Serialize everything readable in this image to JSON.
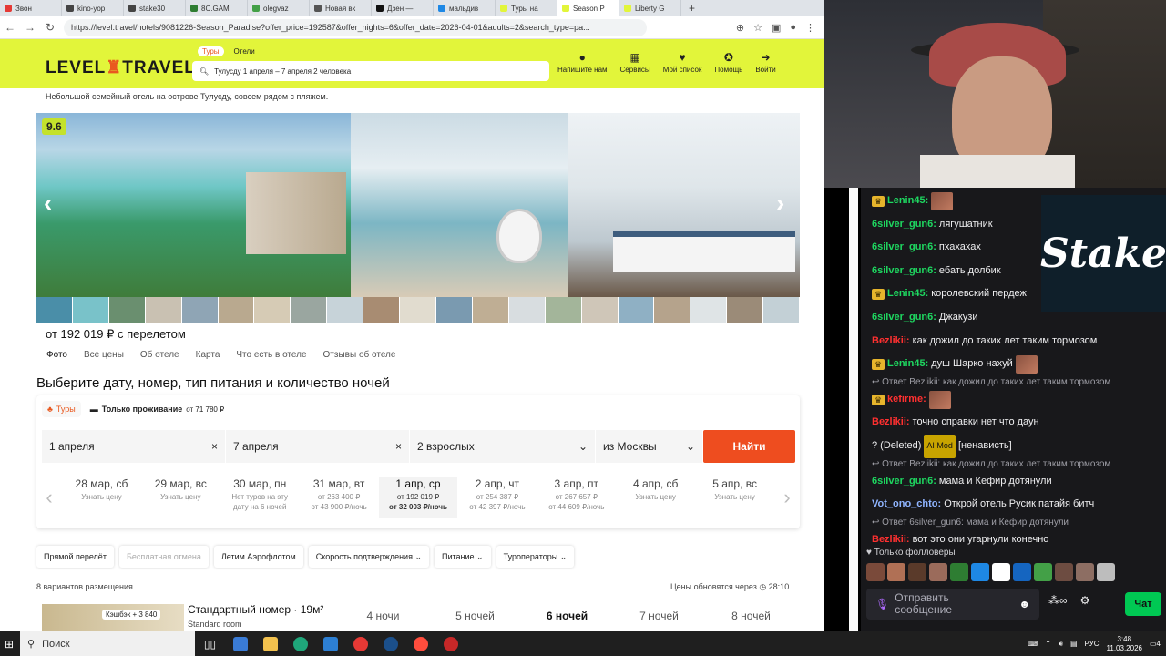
{
  "browser": {
    "tabs": [
      {
        "label": "Звон",
        "color": "#e53935"
      },
      {
        "label": "kino-yop",
        "color": "#444"
      },
      {
        "label": "stake30",
        "color": "#444"
      },
      {
        "label": "8C.GAM",
        "color": "#2e7d32"
      },
      {
        "label": "olegvaz",
        "color": "#43a047"
      },
      {
        "label": "Новая вк",
        "color": "#555"
      },
      {
        "label": "Дзен —",
        "color": "#111"
      },
      {
        "label": "мальдив",
        "color": "#1e88e5"
      },
      {
        "label": "Туры на",
        "color": "#e2f53a"
      },
      {
        "label": "Season P",
        "color": "#e2f53a"
      },
      {
        "label": "Liberty G",
        "color": "#e2f53a"
      }
    ],
    "new_tab": "+",
    "url": "https://level.travel/hotels/9081226-Season_Paradise?offer_price=192587&offer_nights=6&offer_date=2026-04-01&adults=2&search_type=pa..."
  },
  "site": {
    "logo": {
      "part1": "LEVEL",
      "part2": "TRAVEL"
    },
    "search_tabs": [
      "Туры",
      "Отели"
    ],
    "search_summary": "Тулусду 1 апреля – 7 апреля 2 человека",
    "menu": [
      {
        "icon": "●",
        "label": "Напишите нам"
      },
      {
        "icon": "▦",
        "label": "Сервисы"
      },
      {
        "icon": "♥",
        "label": "Мой список"
      },
      {
        "icon": "✪",
        "label": "Помощь"
      },
      {
        "icon": "➜",
        "label": "Войти"
      }
    ],
    "subtitle": "Небольшой семейный отель на острове Тулусду, совсем рядом с пляжем.",
    "rating": "9.6",
    "price_line": "от 192 019 ₽ с перелетом",
    "hotel_tabs": [
      "Фото",
      "Все цены",
      "Об отеле",
      "Карта",
      "Что есть в отеле",
      "Отзывы об отеле"
    ],
    "section_title": "Выберите дату, номер, тип питания и количество ночей",
    "mode": {
      "tours": "Туры",
      "stay": "Только проживание",
      "stay_price": "от 71 780 ₽"
    },
    "search_row": {
      "date_from": "1 апреля",
      "date_to": "7 апреля",
      "guests": "2 взрослых",
      "from": "из Москвы",
      "find": "Найти"
    },
    "dates": [
      {
        "day": "28 мар, сб",
        "line1": "Узнать цену",
        "line2": ""
      },
      {
        "day": "29 мар, вс",
        "line1": "Узнать цену",
        "line2": ""
      },
      {
        "day": "30 мар, пн",
        "line1": "Нет туров на эту",
        "line2": "дату на 6 ночей"
      },
      {
        "day": "31 мар, вт",
        "line1": "от 263 400 ₽",
        "line2": "от 43 900 ₽/ночь"
      },
      {
        "day": "1 апр, ср",
        "line1": "от 192 019 ₽",
        "line2": "от 32 003 ₽/ночь"
      },
      {
        "day": "2 апр, чт",
        "line1": "от 254 387 ₽",
        "line2": "от 42 397 ₽/ночь"
      },
      {
        "day": "3 апр, пт",
        "line1": "от 267 657 ₽",
        "line2": "от 44 609 ₽/ночь"
      },
      {
        "day": "4 апр, сб",
        "line1": "Узнать цену",
        "line2": ""
      },
      {
        "day": "5 апр, вс",
        "line1": "Узнать цену",
        "line2": ""
      }
    ],
    "filters": [
      "Прямой перелёт",
      "Бесплатная отмена",
      "Летим Аэрофлотом",
      "Скорость подтверждения ⌄",
      "Питание ⌄",
      "Туроператоры ⌄"
    ],
    "variants_count": "8 вариантов размещения",
    "prices_update": "Цены обновятся через ◷ 28:10",
    "room": {
      "cashback": "Кэшбэк + 3 840",
      "title": "Стандартный номер · 19м²",
      "subtitle": "Standard room",
      "nights": [
        "4 ночи",
        "5 ночей",
        "6 ночей",
        "7 ночей",
        "8 ночей"
      ]
    }
  },
  "chat": {
    "messages": [
      {
        "user": "Lenin45:",
        "text": "",
        "color": "#1ed760",
        "crown": true,
        "emote": true
      },
      {
        "user": "6silver_gun6:",
        "text": "лягушатник",
        "color": "#1ed760",
        "crown": false,
        "emote": false
      },
      {
        "user": "6silver_gun6:",
        "text": "пхахахах",
        "color": "#1ed760",
        "crown": false,
        "emote": false
      },
      {
        "user": "6silver_gun6:",
        "text": "ебать долбик",
        "color": "#1ed760",
        "crown": false,
        "emote": false
      },
      {
        "user": "Lenin45:",
        "text": "королевский пердеж",
        "color": "#1ed760",
        "crown": true,
        "emote": false
      },
      {
        "user": "6silver_gun6:",
        "text": "Джакузи",
        "color": "#1ed760",
        "crown": false,
        "emote": false
      },
      {
        "user": "Bezlikii:",
        "text": "как дожил до таких лет таким тормозом",
        "color": "#ff3030",
        "crown": false,
        "emote": false
      },
      {
        "user": "Lenin45:",
        "text": "душ Шарко нахуй",
        "color": "#1ed760",
        "crown": true,
        "emote": true
      }
    ],
    "reply1": "↩ Ответ Bezlikii: как дожил до таких лет таким тормозом",
    "messages2": [
      {
        "user": "kefirme:",
        "text": "",
        "color": "#ff3030",
        "crown": true,
        "emote": true
      },
      {
        "user": "Bezlikii:",
        "text": "точно справки нет что даун",
        "color": "#ff3030",
        "crown": false,
        "emote": false
      }
    ],
    "deleted_line": {
      "prefix": "? (Deleted)",
      "badge": "AI Mod",
      "text": "[ненависть]"
    },
    "reply2": "↩ Ответ Bezlikii: как дожил до таких лет таким тормозом",
    "msg_mama": {
      "user": "6silver_gun6:",
      "text": "мама и Кефир дотянули",
      "color": "#1ed760"
    },
    "msg_vot": {
      "user": "Vot_ono_chto:",
      "text": "Открой отель Русик патайя битч",
      "color": "#8fb4ff"
    },
    "reply3": "↩ Ответ 6silver_gun6: мама и Кефир дотянули",
    "msg_last": {
      "user": "Bezlikii:",
      "text": "вот это они угарнули конечно",
      "color": "#ff3030"
    },
    "followers_only": "♥ Только фолловеры",
    "input_placeholder": "Отправить сообщение",
    "send": "Чат",
    "stake_logo": "Stake"
  },
  "taskbar": {
    "search": "Поиск",
    "lang": "РУС",
    "time": "3:48",
    "date": "11.03.2026",
    "notif": "4"
  }
}
